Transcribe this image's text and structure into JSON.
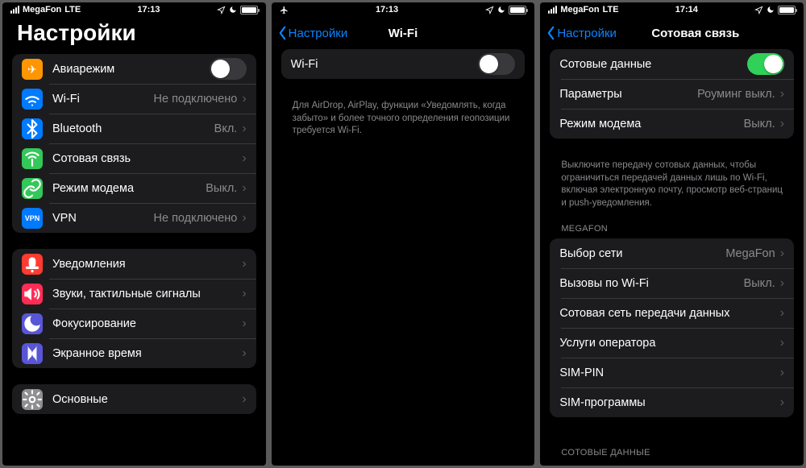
{
  "phones": [
    {
      "status": {
        "carrier": "MegaFon",
        "net": "LTE",
        "time": "17:13"
      },
      "title_large": "Настройки",
      "sections": [
        {
          "rows": [
            {
              "icon": "✈",
              "color": "orange",
              "label": "Авиарежим",
              "toggle": false
            },
            {
              "icon": "wifi",
              "color": "blue",
              "label": "Wi-Fi",
              "value": "Не подключено",
              "chev": true
            },
            {
              "icon": "bt",
              "color": "blue",
              "label": "Bluetooth",
              "value": "Вкл.",
              "chev": true
            },
            {
              "icon": "ant",
              "color": "green",
              "label": "Сотовая связь",
              "chev": true
            },
            {
              "icon": "link",
              "color": "green",
              "label": "Режим модема",
              "value": "Выкл.",
              "chev": true
            },
            {
              "icon": "VPN",
              "color": "vpn",
              "label": "VPN",
              "value": "Не подключено",
              "chev": true
            }
          ]
        },
        {
          "rows": [
            {
              "icon": "bell",
              "color": "red",
              "label": "Уведомления",
              "chev": true
            },
            {
              "icon": "snd",
              "color": "redpink",
              "label": "Звуки, тактильные сигналы",
              "chev": true
            },
            {
              "icon": "moon",
              "color": "purple",
              "label": "Фокусирование",
              "chev": true
            },
            {
              "icon": "hour",
              "color": "purple",
              "label": "Экранное время",
              "chev": true
            }
          ]
        },
        {
          "rows": [
            {
              "icon": "gear",
              "color": "gray",
              "label": "Основные",
              "chev": true
            }
          ]
        }
      ]
    },
    {
      "status": {
        "carrier": "",
        "net": "",
        "time": "17:13",
        "airplane": true
      },
      "back": "Настройки",
      "title": "Wi-Fi",
      "sections": [
        {
          "rows": [
            {
              "label": "Wi-Fi",
              "toggle": false,
              "noicon": true
            }
          ],
          "footer": "Для AirDrop, AirPlay, функции «Уведомлять, когда забыто» и более точного определения геопозиции требуется Wi-Fi."
        }
      ]
    },
    {
      "status": {
        "carrier": "MegaFon",
        "net": "LTE",
        "time": "17:14"
      },
      "back": "Настройки",
      "title": "Сотовая связь",
      "sections": [
        {
          "rows": [
            {
              "label": "Сотовые данные",
              "toggle": true,
              "noicon": true
            },
            {
              "label": "Параметры",
              "value": "Роуминг выкл.",
              "chev": true,
              "noicon": true
            },
            {
              "label": "Режим модема",
              "value": "Выкл.",
              "chev": true,
              "noicon": true
            }
          ],
          "footer": "Выключите передачу сотовых данных, чтобы ограничиться передачей данных лишь по Wi-Fi, включая электронную почту, просмотр веб-страниц и push-уведомления."
        },
        {
          "header": "MEGAFON",
          "rows": [
            {
              "label": "Выбор сети",
              "value": "MegaFon",
              "chev": true,
              "noicon": true
            },
            {
              "label": "Вызовы по Wi-Fi",
              "value": "Выкл.",
              "chev": true,
              "noicon": true
            },
            {
              "label": "Сотовая сеть передачи данных",
              "chev": true,
              "noicon": true
            },
            {
              "label": "Услуги оператора",
              "chev": true,
              "noicon": true
            },
            {
              "label": "SIM-PIN",
              "chev": true,
              "noicon": true
            },
            {
              "label": "SIM-программы",
              "chev": true,
              "noicon": true
            }
          ]
        },
        {
          "header": "СОТОВЫЕ ДАННЫЕ",
          "rows": []
        }
      ]
    }
  ]
}
